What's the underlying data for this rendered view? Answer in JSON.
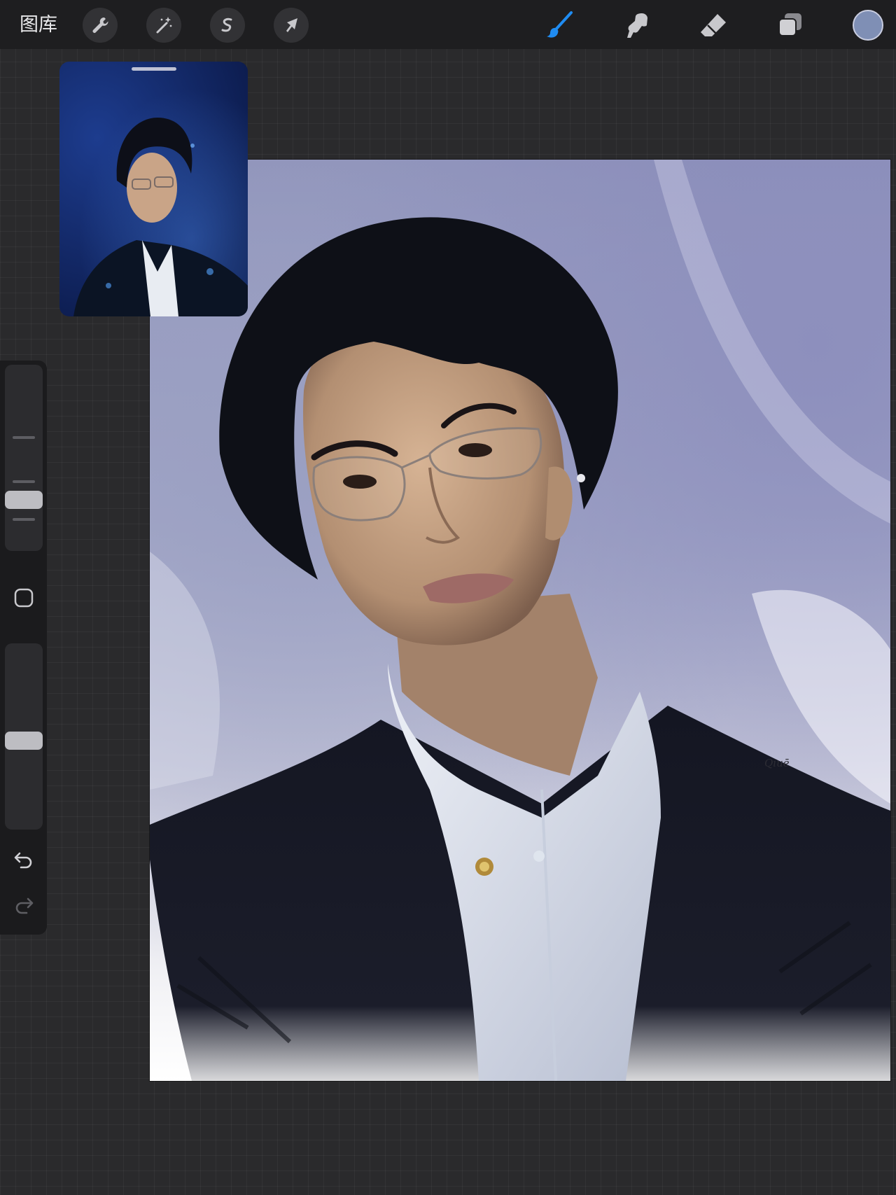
{
  "toolbar": {
    "gallery_label": "图库",
    "left_tools": [
      "wrench-icon",
      "magic-wand-icon",
      "selection-icon",
      "transform-arrow-icon"
    ],
    "right_tools": [
      "brush-icon",
      "smudge-icon",
      "eraser-icon",
      "layers-icon"
    ],
    "active_tool": "brush-icon",
    "current_color": "#7f8fb5",
    "accent_color": "#1f8cf2"
  },
  "sidebar": {
    "items": [
      "brush-size-slider",
      "modify-button",
      "opacity-slider",
      "undo-icon",
      "redo-icon"
    ]
  },
  "canvas": {
    "signature": "Qiuē"
  }
}
